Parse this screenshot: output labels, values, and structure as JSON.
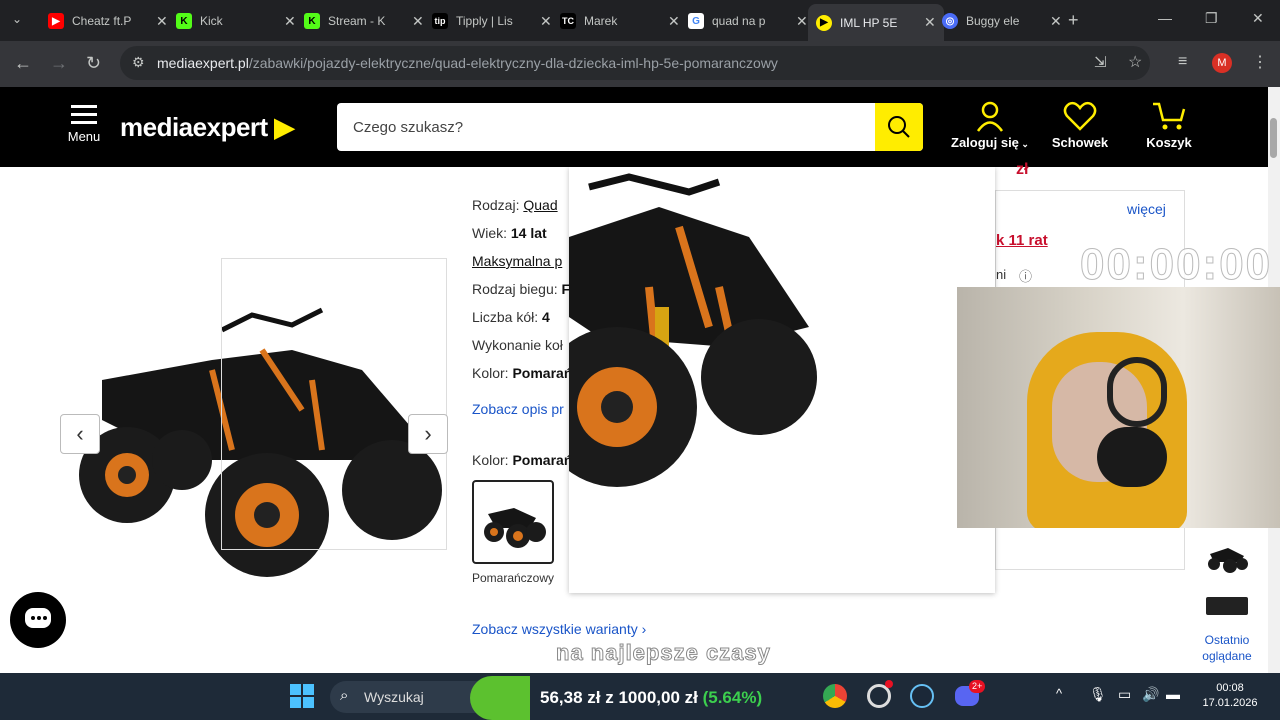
{
  "browser": {
    "tabs": [
      {
        "title": "Cheatz ft.P",
        "icon": "youtube-icon",
        "color": "#ff0000"
      },
      {
        "title": "Kick",
        "icon": "kick-icon",
        "color": "#53fc18"
      },
      {
        "title": "Stream - K",
        "icon": "kick-icon",
        "color": "#53fc18"
      },
      {
        "title": "Tipply | Lis",
        "icon": "tipply-icon",
        "color": "#ffffff"
      },
      {
        "title": "Marek",
        "icon": "tc-icon",
        "color": "#ffffff"
      },
      {
        "title": "quad na p",
        "icon": "google-icon",
        "color": "#ffffff"
      },
      {
        "title": "IML HP 5E",
        "icon": "mediaexpert-icon",
        "color": "#ffed00"
      },
      {
        "title": "Buggy ele",
        "icon": "buggy-icon",
        "color": "#4a6cf7"
      }
    ],
    "url_domain": "mediaexpert.pl",
    "url_path": "/zabawki/pojazdy-elektryczne/quad-elektryczny-dla-dziecka-iml-hp-5e-pomaranczowy",
    "profile_initial": "M"
  },
  "site": {
    "menu_label": "Menu",
    "logo_main": "mediaexpert",
    "search_placeholder": "Czego szukasz?",
    "login_label": "Zaloguj się",
    "wishlist_label": "Schowek",
    "cart_label": "Koszyk",
    "accent": "#ffed00"
  },
  "product": {
    "specs": {
      "type_label": "Rodzaj:",
      "type_value": "Quad",
      "age_label": "Wiek:",
      "age_value": "14 lat",
      "max_label": "Maksymalna p",
      "gear_label": "Rodzaj biegu:",
      "gear_value": "F",
      "wheels_label": "Liczba kół:",
      "wheels_value": "4",
      "finish_label": "Wykonanie koł",
      "color_label": "Kolor:",
      "color_value": "Pomarań"
    },
    "desc_link": "Zobacz opis pr",
    "color2_label": "Kolor:",
    "color2_value": "Pomarań",
    "thumb_caption": "Pomarańczowy",
    "variants_link": "Zobacz wszystkie warianty"
  },
  "right_panel": {
    "more": "więcej",
    "installments": "k 11 rat",
    "info": "ni",
    "price_fragment": "zł"
  },
  "overlay": {
    "timer": "00:00:00",
    "caption": "na najlepsze czasy"
  },
  "recent": {
    "label_line1": "Ostatnio",
    "label_line2": "oglądane"
  },
  "taskbar": {
    "search_label": "Wyszukaj",
    "ticker_amount": "56,38 zł",
    "ticker_sep": " z ",
    "ticker_goal": "1000,00 zł",
    "ticker_pct": " (5.64%)",
    "notification_badge": "2+",
    "time": "00:08",
    "date": "17.01.2026"
  }
}
